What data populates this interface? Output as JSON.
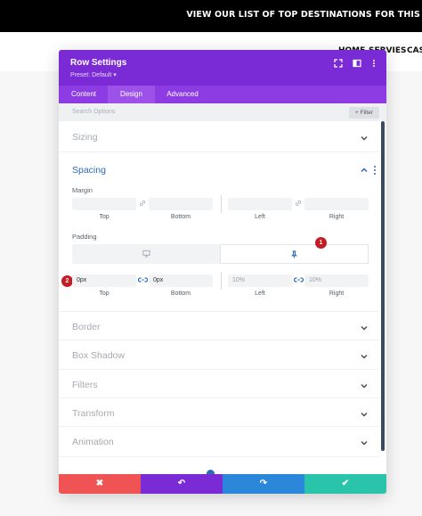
{
  "banner": {
    "text": "VIEW OUR LIST OF TOP DESTINATIONS FOR THIS"
  },
  "nav": {
    "items": [
      "HOME",
      "SERVIES",
      "CAS"
    ]
  },
  "modal": {
    "title": "Row Settings",
    "preset": "Preset: Default ▾",
    "icons": [
      "expand-icon",
      "split-view-icon",
      "more-icon"
    ],
    "tabs": [
      {
        "label": "Content",
        "active": false
      },
      {
        "label": "Design",
        "active": true
      },
      {
        "label": "Advanced",
        "active": false
      }
    ],
    "search_placeholder": "Search Options",
    "filter_label": "+ Filter",
    "sections": {
      "sizing": "Sizing",
      "spacing": "Spacing",
      "border": "Border",
      "box_shadow": "Box Shadow",
      "filters": "Filters",
      "transform": "Transform",
      "animation": "Animation"
    },
    "margin": {
      "label": "Margin",
      "sides": [
        "Top",
        "Bottom",
        "Left",
        "Right"
      ],
      "values": [
        "",
        "",
        "",
        ""
      ]
    },
    "padding": {
      "label": "Padding",
      "sides": [
        "Top",
        "Bottom",
        "Left",
        "Right"
      ],
      "values": [
        "0px",
        "0px",
        "10%",
        "10%"
      ]
    },
    "badges": [
      "1",
      "2"
    ],
    "footer": {
      "cancel": "✖",
      "undo": "↶",
      "redo": "↷",
      "save": "✔"
    }
  },
  "colors": {
    "header_purple": "#7b2bd6",
    "tab_purple": "#8d3be2",
    "accent_blue": "#2d6bb4",
    "cancel_red": "#ef5353",
    "undo_purple": "#7b2bd6",
    "redo_blue": "#2b87da",
    "save_green": "#29c4a9",
    "badge_red": "#c51c23"
  }
}
